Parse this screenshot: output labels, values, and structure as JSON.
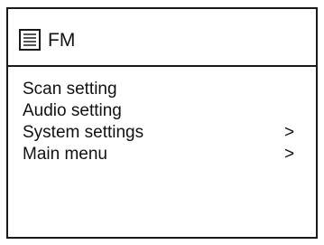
{
  "header": {
    "icon": "menu-list-icon",
    "title": "FM"
  },
  "menu": {
    "items": [
      {
        "label": "Scan setting",
        "arrow": ""
      },
      {
        "label": "Audio setting",
        "arrow": ""
      },
      {
        "label": "System settings",
        "arrow": ">"
      },
      {
        "label": "Main menu",
        "arrow": ">"
      }
    ]
  }
}
